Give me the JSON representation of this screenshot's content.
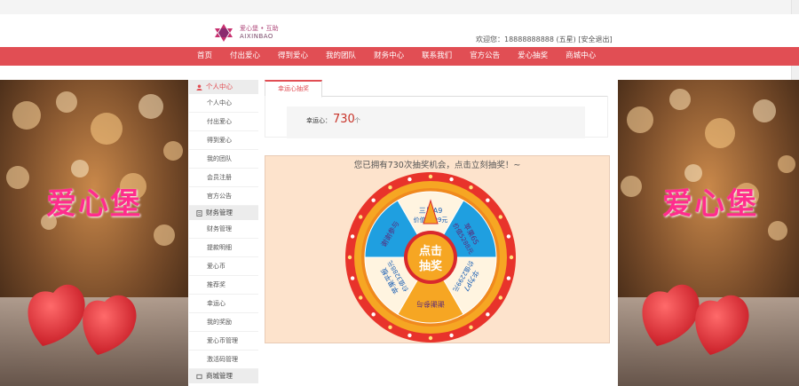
{
  "header": {
    "logo_cn": "爱心堡 • 互助",
    "logo_en": "AIXINBAO",
    "welcome": "欢迎您：18888888888",
    "level": "(五星)",
    "logout": "[安全退出]"
  },
  "nav": [
    "首页",
    "付出爱心",
    "得到爱心",
    "我的团队",
    "财务中心",
    "联系我们",
    "官方公告",
    "爱心抽奖",
    "商城中心"
  ],
  "banner": {
    "slogan": "爱心堡"
  },
  "sidebar": {
    "group1": "个人中心",
    "group1_items": [
      "个人中心",
      "付出爱心",
      "得到爱心",
      "我的团队",
      "会员注册",
      "官方公告"
    ],
    "group2": "财务管理",
    "group2_items": [
      "财务管理",
      "提款明细",
      "爱心币",
      "推荐奖",
      "幸运心",
      "我的奖励",
      "爱心币管理",
      "激活码管理"
    ],
    "group3": "商城管理"
  },
  "main": {
    "tab": "幸运心抽奖",
    "lucky_label": "幸运心：",
    "lucky_value": "730",
    "lucky_unit": "个",
    "lottery_msg": "您已拥有730次抽奖机会，点击立刻抽奖！~",
    "center_line1": "点击",
    "center_line2": "抽奖",
    "prizes": [
      {
        "line1": "三星A9",
        "line2": "价值1999元"
      },
      {
        "line1": "苹果6S",
        "line2": "价值5288元"
      },
      {
        "line1": "华为P7",
        "line2": "价值2299元"
      },
      {
        "line1": "谢谢参与",
        "line2": ""
      },
      {
        "line1": "苹果平板",
        "line2": "价值3288元"
      },
      {
        "line1": "谢谢参与",
        "line2": ""
      }
    ]
  },
  "colors": {
    "brand_red": "#e14e54",
    "gold": "#f6a623",
    "blue": "#1f9fe0",
    "wheel_red": "#d9282d"
  }
}
